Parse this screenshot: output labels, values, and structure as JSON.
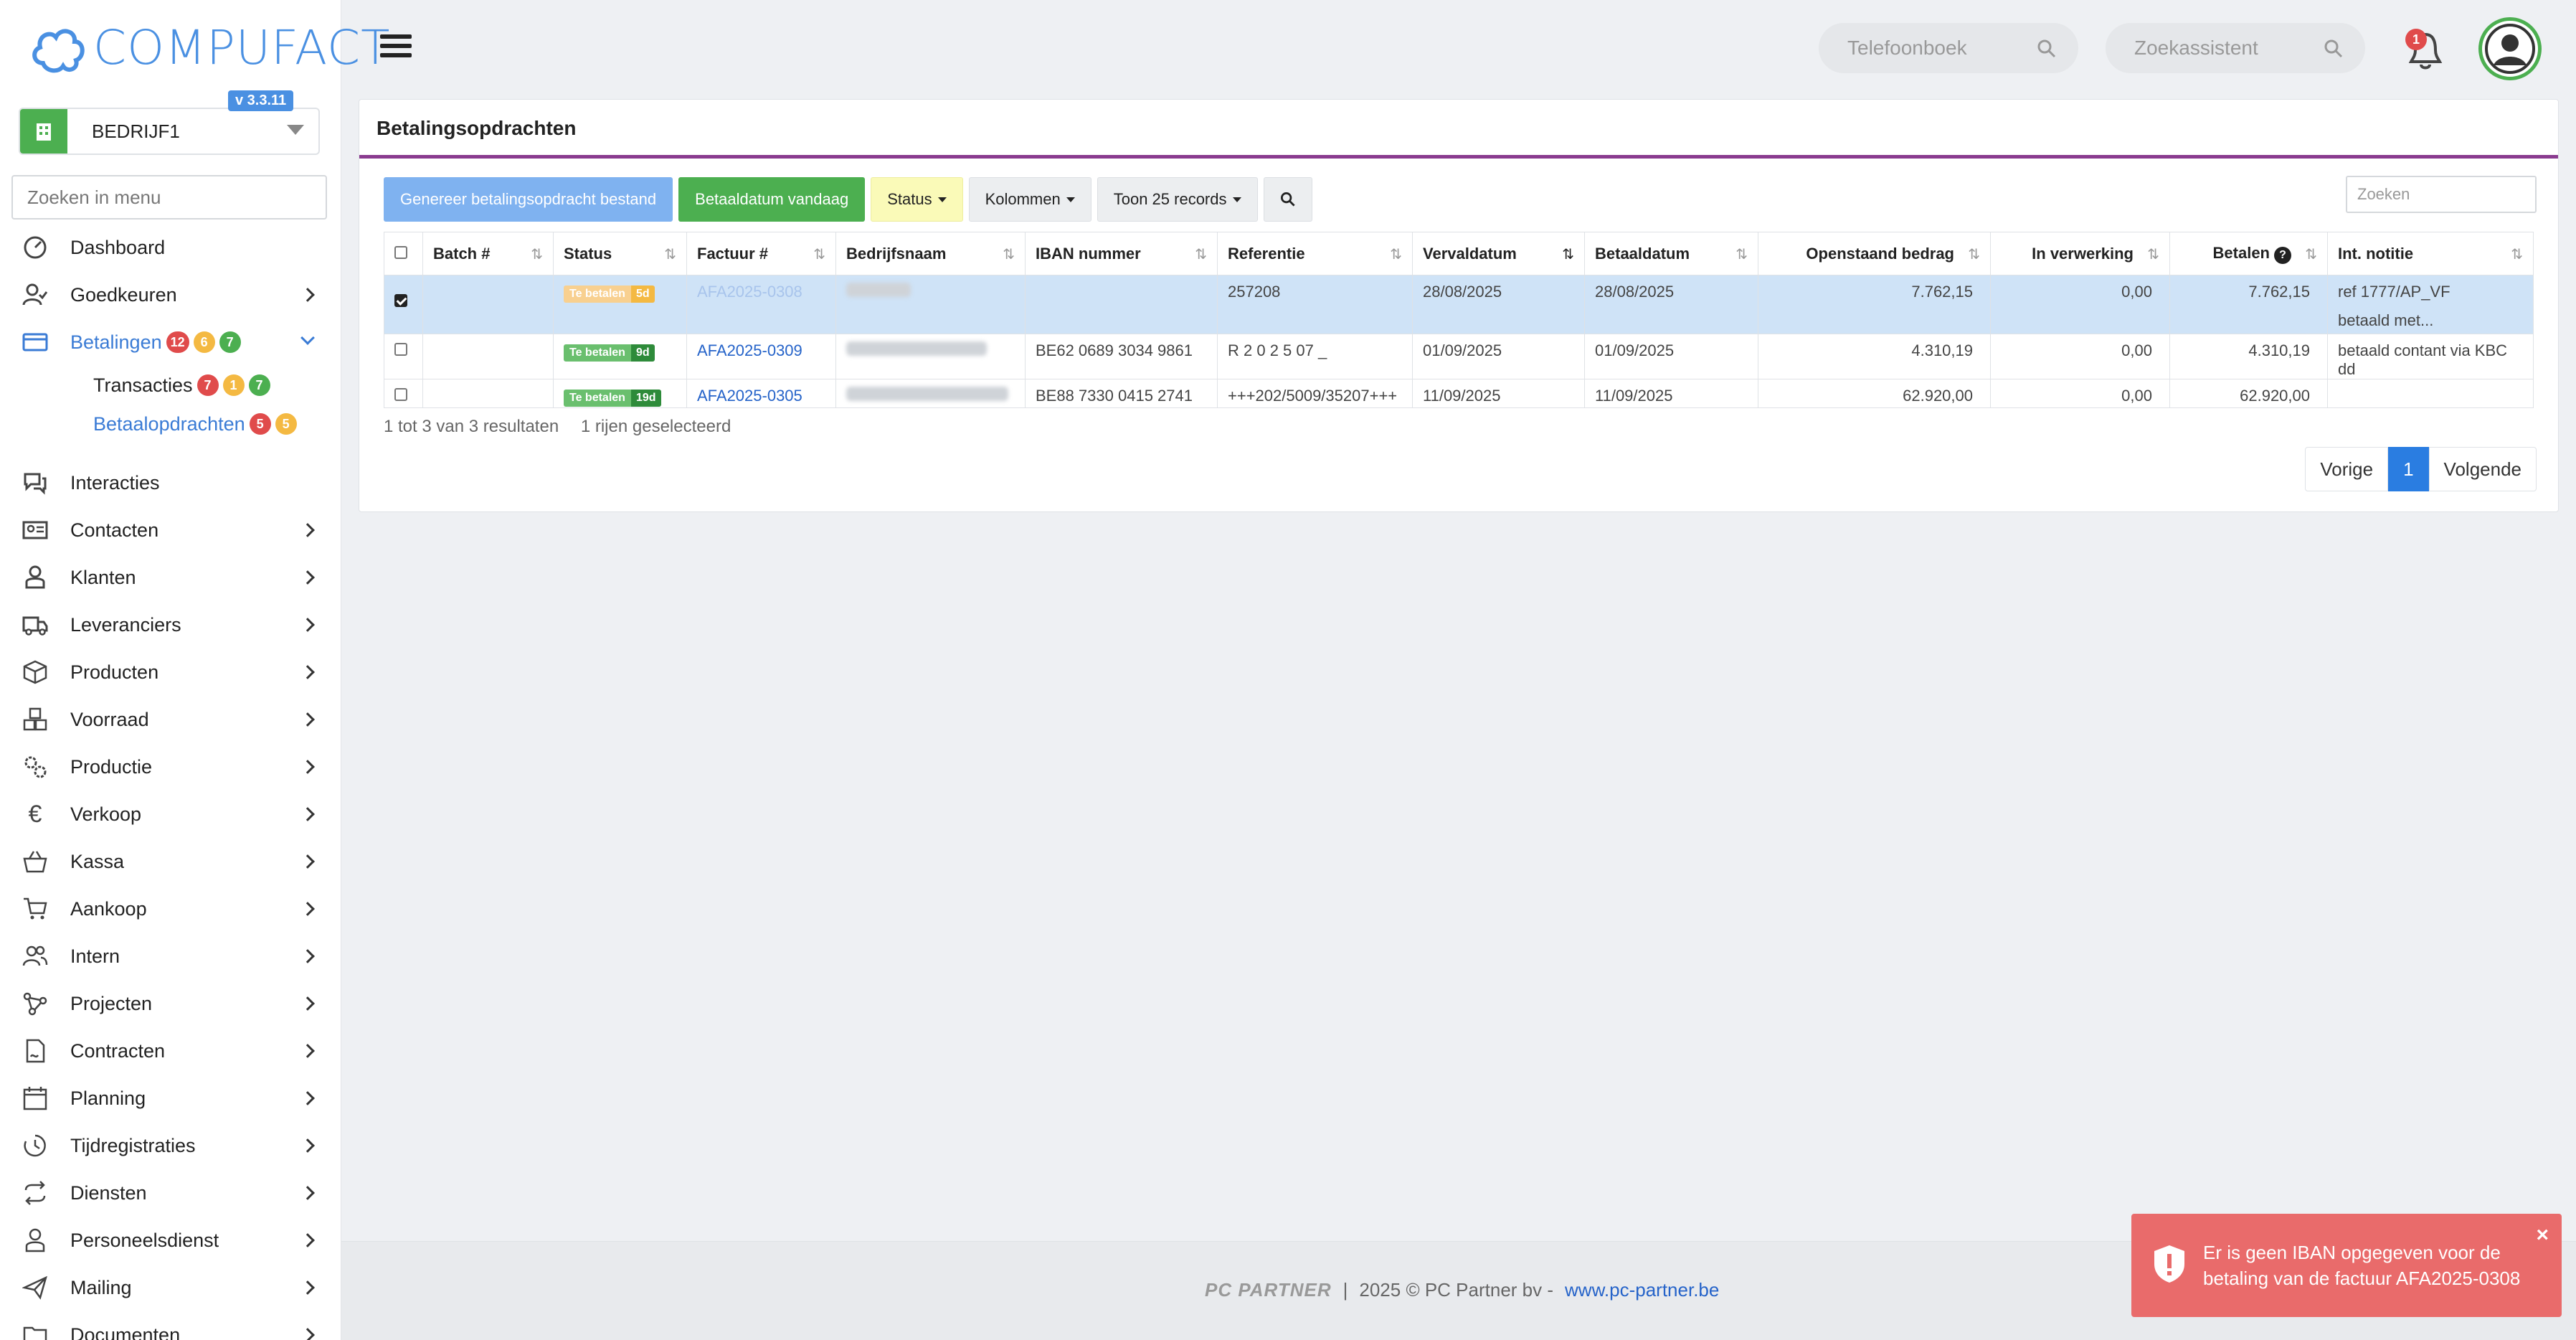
{
  "brand": {
    "logo_text": "COMPUFACT",
    "version": "v 3.3.11"
  },
  "company": {
    "name": "BEDRIJF1"
  },
  "menu_search": {
    "placeholder": "Zoeken in menu"
  },
  "menu": {
    "items": [
      {
        "label": "Dashboard",
        "icon": "dashboard-icon"
      },
      {
        "label": "Goedkeuren",
        "icon": "user-check-icon"
      },
      {
        "label": "Betalingen",
        "icon": "credit-card-icon",
        "badges": [
          "12",
          "6",
          "7"
        ]
      },
      {
        "label": "Interacties",
        "icon": "chat-icon"
      },
      {
        "label": "Contacten",
        "icon": "contact-card-icon"
      },
      {
        "label": "Klanten",
        "icon": "customer-icon"
      },
      {
        "label": "Leveranciers",
        "icon": "truck-icon"
      },
      {
        "label": "Producten",
        "icon": "box-icon"
      },
      {
        "label": "Voorraad",
        "icon": "boxes-icon"
      },
      {
        "label": "Productie",
        "icon": "gears-icon"
      },
      {
        "label": "Verkoop",
        "icon": "euro-icon"
      },
      {
        "label": "Kassa",
        "icon": "basket-icon"
      },
      {
        "label": "Aankoop",
        "icon": "cart-icon"
      },
      {
        "label": "Intern",
        "icon": "users-icon"
      },
      {
        "label": "Projecten",
        "icon": "nodes-icon"
      },
      {
        "label": "Contracten",
        "icon": "contract-icon"
      },
      {
        "label": "Planning",
        "icon": "calendar-icon"
      },
      {
        "label": "Tijdregistraties",
        "icon": "clock-icon"
      },
      {
        "label": "Diensten",
        "icon": "repeat-icon"
      },
      {
        "label": "Personeelsdienst",
        "icon": "person-icon"
      },
      {
        "label": "Mailing",
        "icon": "send-icon"
      },
      {
        "label": "Documenten",
        "icon": "folder-icon"
      }
    ],
    "submenu": [
      {
        "label": "Transacties",
        "badges": [
          "7",
          "1",
          "7"
        ]
      },
      {
        "label": "Betaalopdrachten",
        "badges": [
          "5",
          "5"
        ]
      }
    ]
  },
  "topbar": {
    "phonebook_placeholder": "Telefoonboek",
    "assistant_placeholder": "Zoekassistent",
    "notification_count": "1"
  },
  "page": {
    "title": "Betalingsopdrachten"
  },
  "toolbar": {
    "generate_label": "Genereer betalingsopdracht bestand",
    "paydate_label": "Betaaldatum vandaag",
    "status_label": "Status",
    "columns_label": "Kolommen",
    "show_label": "Toon 25 records",
    "search_placeholder": "Zoeken"
  },
  "table": {
    "columns": [
      "Batch #",
      "Status",
      "Factuur #",
      "Bedrijfsnaam",
      "IBAN nummer",
      "Referentie",
      "Vervaldatum",
      "Betaaldatum",
      "Openstaand bedrag",
      "In verwerking",
      "Betalen",
      "Int. notitie"
    ],
    "rows": [
      {
        "selected": true,
        "batch": "",
        "status": "Te betalen",
        "days": "5d",
        "invoice": "AFA2025-0308",
        "iban": "",
        "reference": "257208",
        "due": "28/08/2025",
        "paydate": "28/08/2025",
        "open": "7.762,15",
        "processing": "0,00",
        "pay": "7.762,15",
        "note": "ref 1777/AP_VF",
        "note2": "betaald met..."
      },
      {
        "selected": false,
        "batch": "",
        "status": "Te betalen",
        "days": "9d",
        "invoice": "AFA2025-0309",
        "iban": "BE62 0689 3034 9861",
        "reference": "R 2 0 2 5 07 _",
        "due": "01/09/2025",
        "paydate": "01/09/2025",
        "open": "4.310,19",
        "processing": "0,00",
        "pay": "4.310,19",
        "note": "betaald contant via KBC dd",
        "note2": ""
      },
      {
        "selected": false,
        "batch": "",
        "status": "Te betalen",
        "days": "19d",
        "invoice": "AFA2025-0305",
        "iban": "BE88 7330 0415 2741",
        "reference": "+++202/5009/35207+++",
        "due": "11/09/2025",
        "paydate": "11/09/2025",
        "open": "62.920,00",
        "processing": "0,00",
        "pay": "62.920,00",
        "note": "",
        "note2": ""
      }
    ]
  },
  "results": {
    "summary": "1 tot 3 van 3 resultaten",
    "selected": "1 rijen geselecteerd"
  },
  "pager": {
    "prev": "Vorige",
    "page": "1",
    "next": "Volgende"
  },
  "footer": {
    "logo": "PC PARTNER",
    "sep": "|",
    "copyright": "2025 © PC Partner bv -",
    "link": "www.pc-partner.be"
  },
  "toast": {
    "message": "Er is geen IBAN opgegeven voor de betaling van de factuur AFA2025-0308",
    "close": "×"
  },
  "colors": {
    "accent": "#3a7bd5",
    "header_rule": "#8a3b8f",
    "success": "#4caf50",
    "danger": "#e96b6b"
  }
}
